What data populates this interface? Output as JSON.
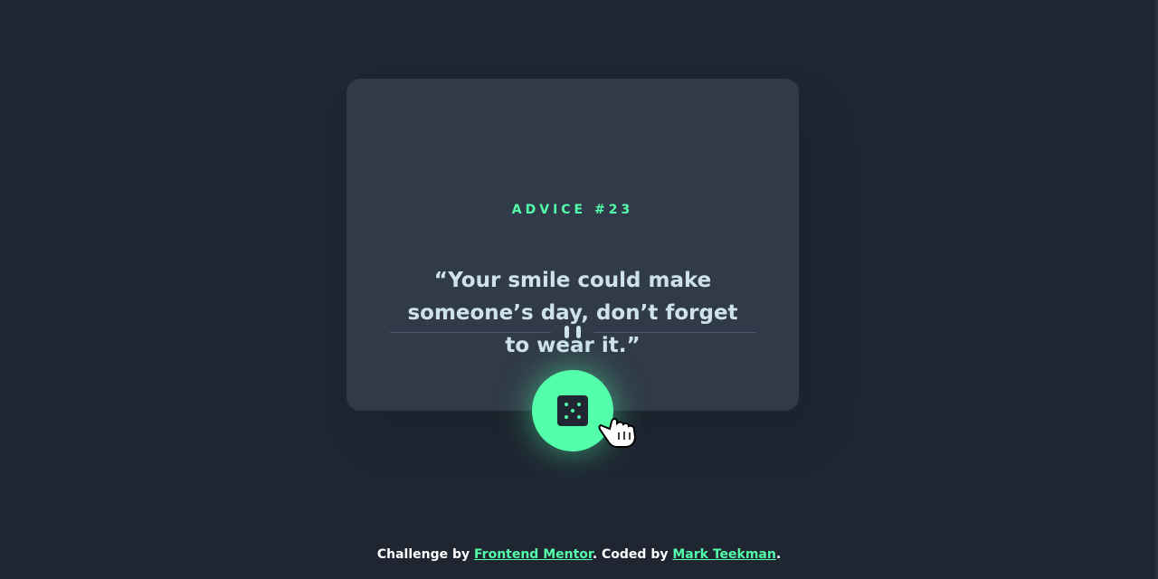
{
  "card": {
    "advice_label": "ADVICE #23",
    "quote": "“Your smile could make someone’s day, don’t forget to wear it.”"
  },
  "divider": {
    "icon": "pause-icon"
  },
  "dice_button": {
    "icon": "dice-icon"
  },
  "footer": {
    "prefix": "Challenge by ",
    "challenge_link": "Frontend Mentor",
    "middle": ". Coded by ",
    "author_link": "Mark Teekman",
    "suffix": "."
  },
  "colors": {
    "background": "#1f2632",
    "card": "#313a48",
    "accent": "#53ffaa",
    "text": "#cee3e9",
    "divider": "#4f5d74"
  }
}
